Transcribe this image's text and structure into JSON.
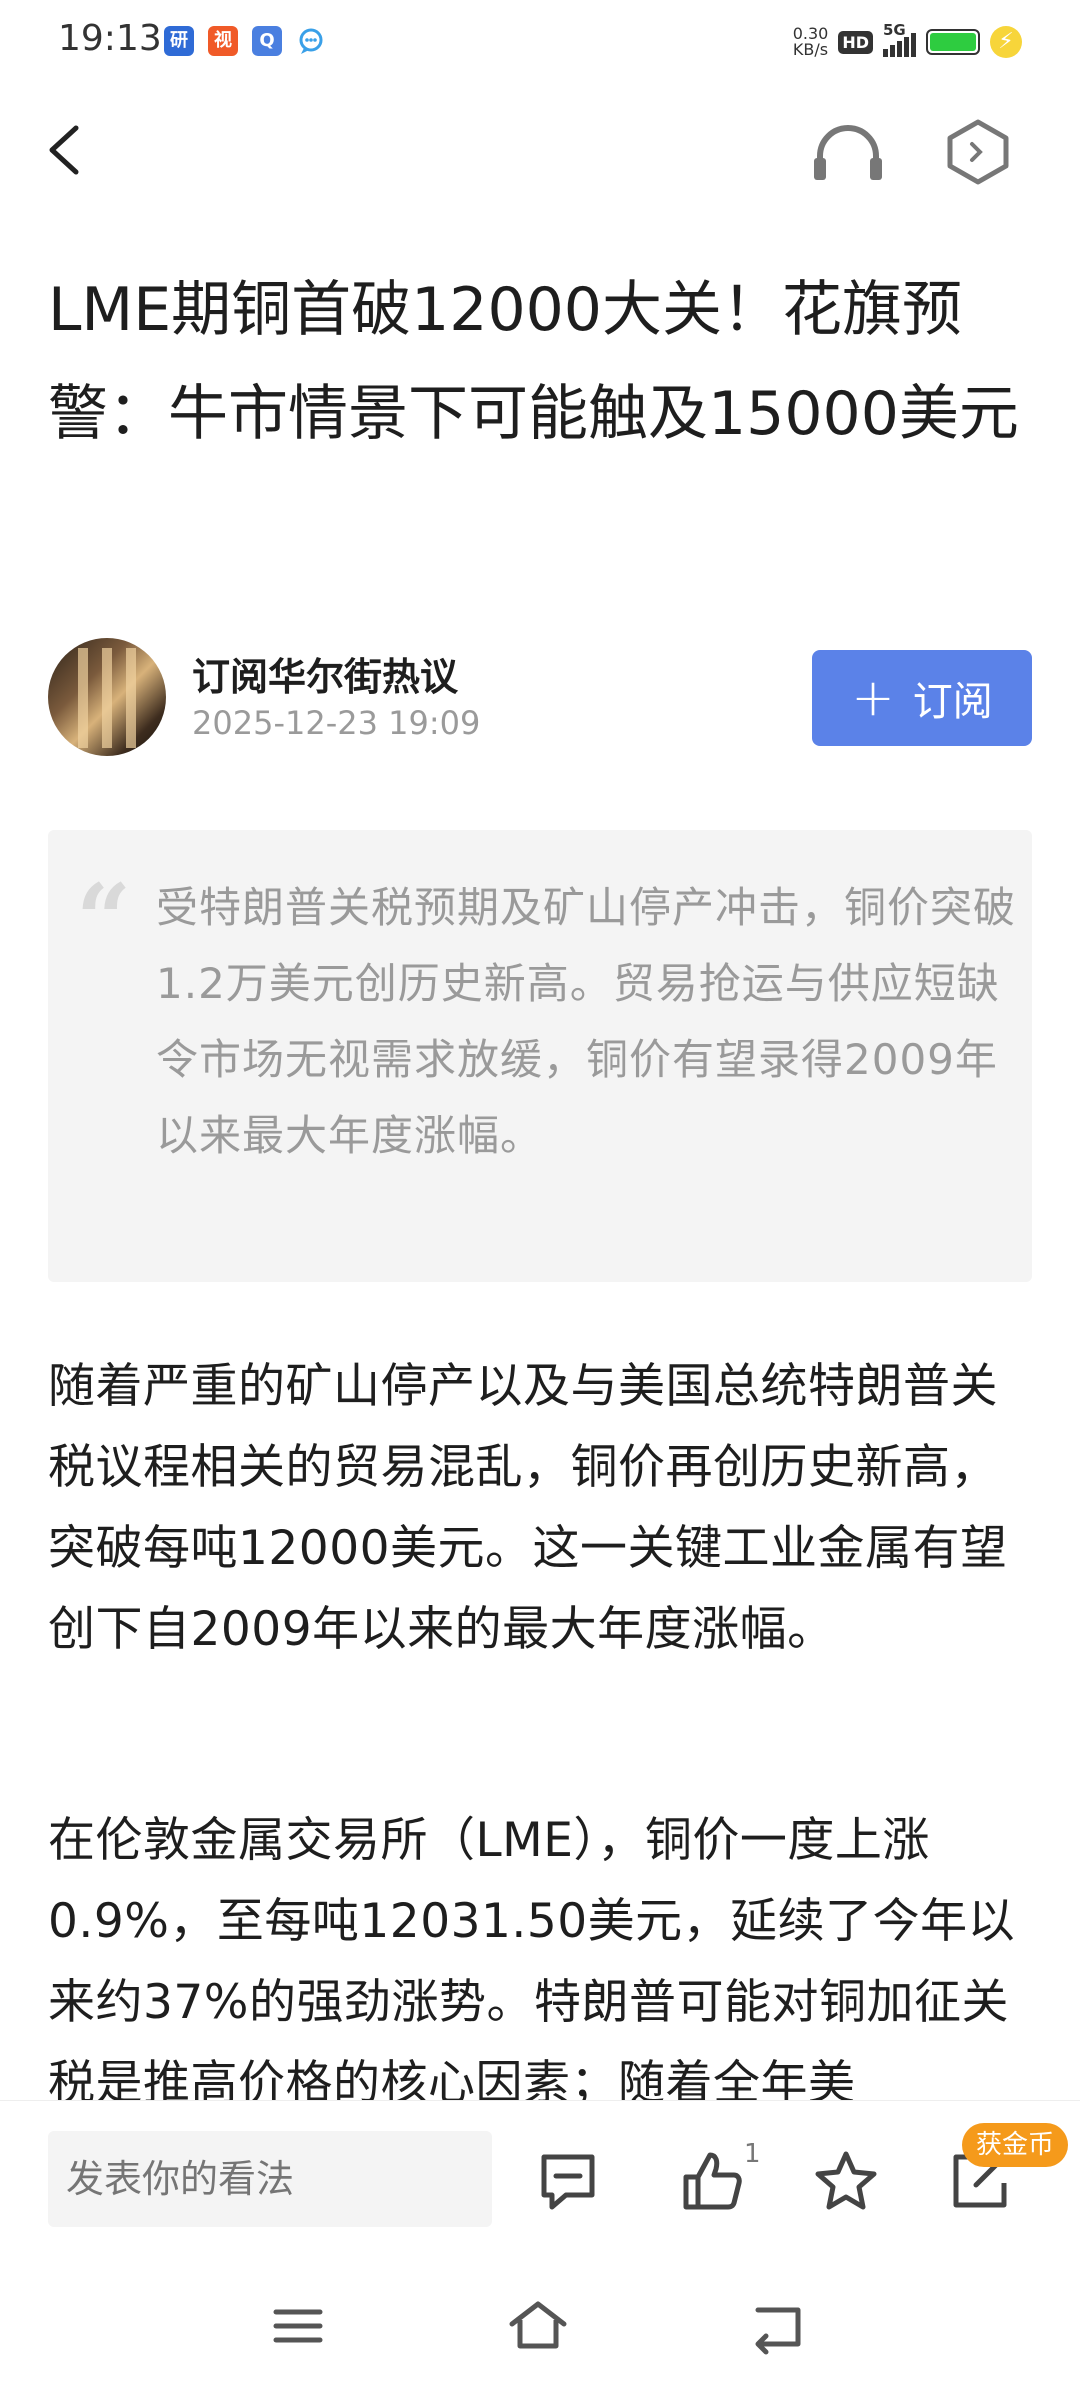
{
  "status_bar": {
    "time": "19:13",
    "apps": [
      {
        "icon": "news-app-icon",
        "glyph": "研",
        "color": "#2f6bd6"
      },
      {
        "icon": "video-app-icon",
        "glyph": "视",
        "color": "#f05a28"
      },
      {
        "icon": "browser-app-icon",
        "glyph": "Q",
        "color": "#4a7fe0"
      },
      {
        "icon": "message-app-icon",
        "glyph": "",
        "color": "#3aa0e8"
      }
    ],
    "net_speed_value": "0.30",
    "net_speed_unit": "KB/s",
    "hd_label": "HD",
    "network_label": "5G",
    "battery_color": "#2ecc40"
  },
  "nav": {
    "back_icon": "back-arrow-icon",
    "audio_icon": "headphones-icon",
    "more_icon": "hexagon-icon"
  },
  "article": {
    "title": "LME期铜首破12000大关！花旗预警：牛市情景下可能触及15000美元",
    "author_name": "订阅华尔街热议",
    "publish_time": "2025-12-23 19:09",
    "subscribe_label": "订阅",
    "subscribe_icon": "+",
    "summary_quote_icon": "“",
    "summary": "受特朗普关税预期及矿山停产冲击，铜价突破1.2万美元创历史新高。贸易抢运与供应短缺令市场无视需求放缓，铜价有望录得2009年以来最大年度涨幅。",
    "paragraphs": [
      "随着严重的矿山停产以及与美国总统特朗普关税议程相关的贸易混乱，铜价再创历史新高，突破每吨12000美元。这一关键工业金属有望创下自2009年以来的最大年度涨幅。",
      "在伦敦金属交易所（LME），铜价一度上涨0.9%，至每吨12031.50美元，延续了今年以来约37%的强劲涨势。特朗普可能对铜加征关税是推高价格的核心因素；随着全年美"
    ]
  },
  "bottom_bar": {
    "comment_placeholder": "发表你的看法",
    "like_count": "1",
    "coin_badge": "获金币",
    "accent_color": "#5b82e8"
  }
}
